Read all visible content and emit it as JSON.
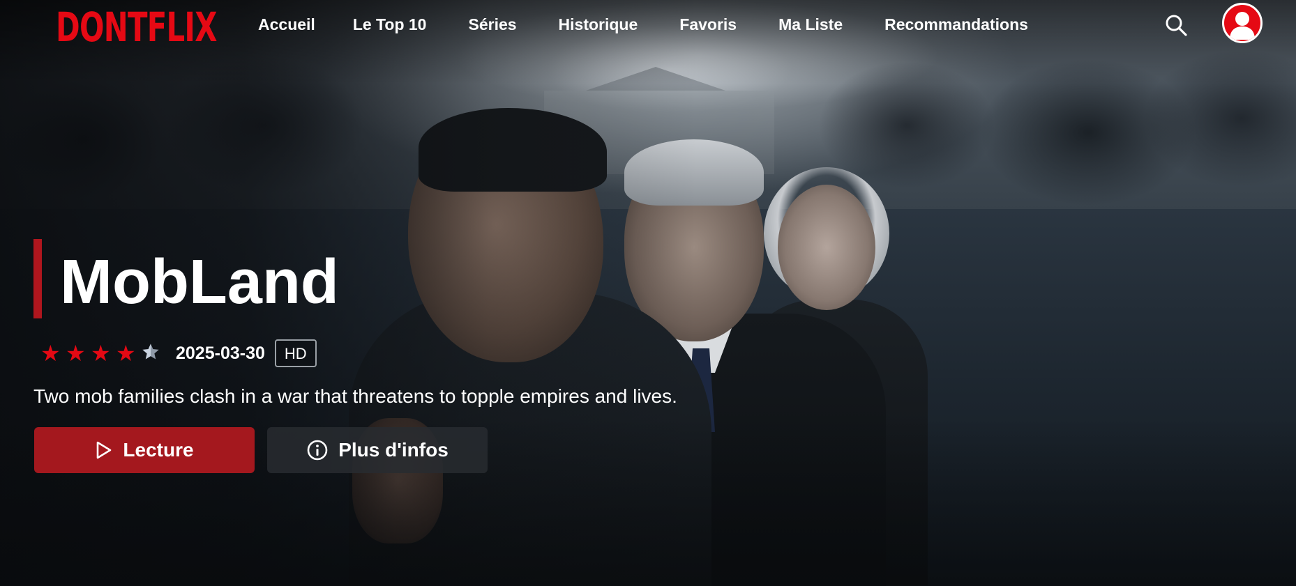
{
  "app": {
    "logo": "DONTFLIX",
    "accent_color": "#e50914",
    "button_color": "#a4181e"
  },
  "nav": {
    "items": [
      {
        "label": "Accueil"
      },
      {
        "label": "Le Top 10"
      },
      {
        "label": "Séries"
      },
      {
        "label": "Historique"
      },
      {
        "label": "Favoris"
      },
      {
        "label": "Ma Liste"
      },
      {
        "label": "Recommandations"
      }
    ],
    "search_icon": "search-icon",
    "avatar_icon": "user-avatar-icon"
  },
  "hero": {
    "title": "MobLand",
    "rating": {
      "value": 4.5,
      "max": 5
    },
    "release_date": "2025-03-30",
    "quality_badge": "HD",
    "description": "Two mob families clash in a war that threatens to topple empires and lives.",
    "play_button": {
      "label": "Lecture",
      "icon": "play-icon"
    },
    "info_button": {
      "label": "Plus d'infos",
      "icon": "info-icon"
    }
  }
}
